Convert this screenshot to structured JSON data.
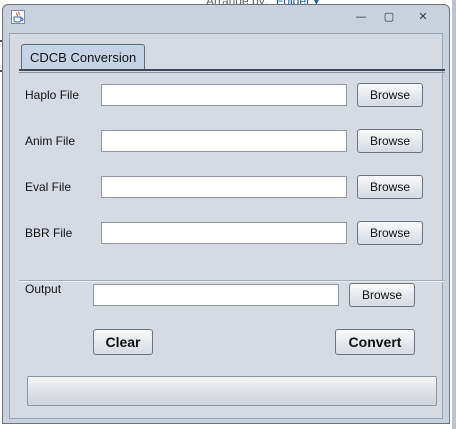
{
  "background": {
    "arrange_label": "Arrange by:",
    "arrange_value": "Folder ▾"
  },
  "window": {
    "icon": "java-icon",
    "controls": {
      "minimize": "—",
      "maximize": "▢",
      "close": "✕"
    }
  },
  "tab": {
    "label": "CDCB Conversion"
  },
  "files": [
    {
      "label": "Haplo File",
      "value": "",
      "button": "Browse"
    },
    {
      "label": "Anim File",
      "value": "",
      "button": "Browse"
    },
    {
      "label": "Eval File",
      "value": "",
      "button": "Browse"
    },
    {
      "label": "BBR File",
      "value": "",
      "button": "Browse"
    }
  ],
  "output": {
    "label": "Output",
    "value": "",
    "button": "Browse"
  },
  "actions": {
    "clear": "Clear",
    "convert": "Convert"
  },
  "progress": {
    "fraction": 0
  },
  "colors": {
    "window_bg": "#c9d1dc",
    "panel_bg": "#d6dae2",
    "tab_bg": "#c4d3e6",
    "link": "#1b5db4"
  }
}
